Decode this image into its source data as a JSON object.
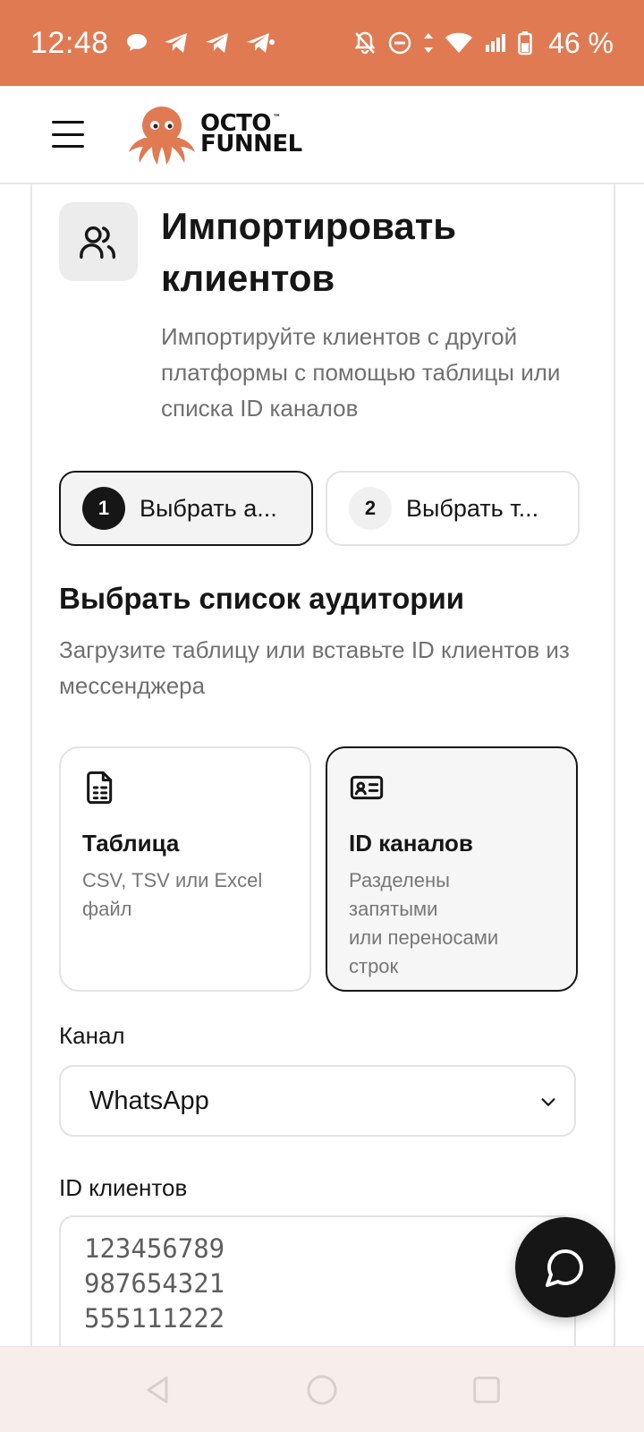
{
  "status_bar": {
    "time": "12:48",
    "battery": "46 %"
  },
  "header": {
    "logo_line1": "OCTO",
    "logo_tm": "™",
    "logo_line2": "FUNNEL"
  },
  "page": {
    "title": "Импортировать клиентов",
    "subtitle": "Импортируйте клиентов с другой платформы с помощью таблицы или списка ID каналов"
  },
  "steps": [
    {
      "number": "1",
      "label": "Выбрать а..."
    },
    {
      "number": "2",
      "label": "Выбрать т..."
    }
  ],
  "section": {
    "title": "Выбрать список аудитории",
    "description": "Загрузите таблицу или вставьте ID клиентов из мессенджера"
  },
  "options": {
    "table": {
      "title": "Таблица",
      "description": "CSV, TSV или Excel\nфайл"
    },
    "ids": {
      "title": "ID каналов",
      "description": "Разделены\nзапятыми\nили переносами\nстрок"
    }
  },
  "form": {
    "channel_label": "Канал",
    "channel_value": "WhatsApp",
    "ids_label": "ID клиентов",
    "ids_value": "123456789\n987654321\n555111222"
  },
  "colors": {
    "status_bar": "#e07a53",
    "logo_octopus": "#e07a53",
    "text_primary": "#161616",
    "text_muted": "#707070"
  }
}
